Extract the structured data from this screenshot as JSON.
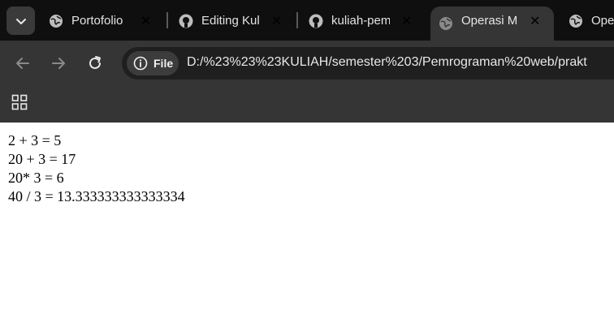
{
  "tabs": [
    {
      "title": "Portofolio",
      "favicon": "globe-icon",
      "active": false
    },
    {
      "title": "Editing Kul",
      "favicon": "github-icon",
      "active": false
    },
    {
      "title": "kuliah-pem",
      "favicon": "github-icon",
      "active": false
    },
    {
      "title": "Operasi M",
      "favicon": "globe-icon",
      "active": true
    },
    {
      "title": "Ope",
      "favicon": "globe-icon",
      "active": false
    }
  ],
  "toolbar": {
    "chip_label": "File",
    "url": "D:/%23%23%23KULIAH/semester%203/Pemrograman%20web/prakt"
  },
  "content": {
    "lines": [
      "2 + 3 = 5",
      "20 + 3 = 17",
      "20* 3 = 6",
      "40 / 3 = 13.333333333333334"
    ]
  },
  "colors": {
    "tabstrip": "#0f0f0f",
    "toolbar": "#353535",
    "omnibox": "#1f1f1f",
    "page": "#ffffff"
  }
}
